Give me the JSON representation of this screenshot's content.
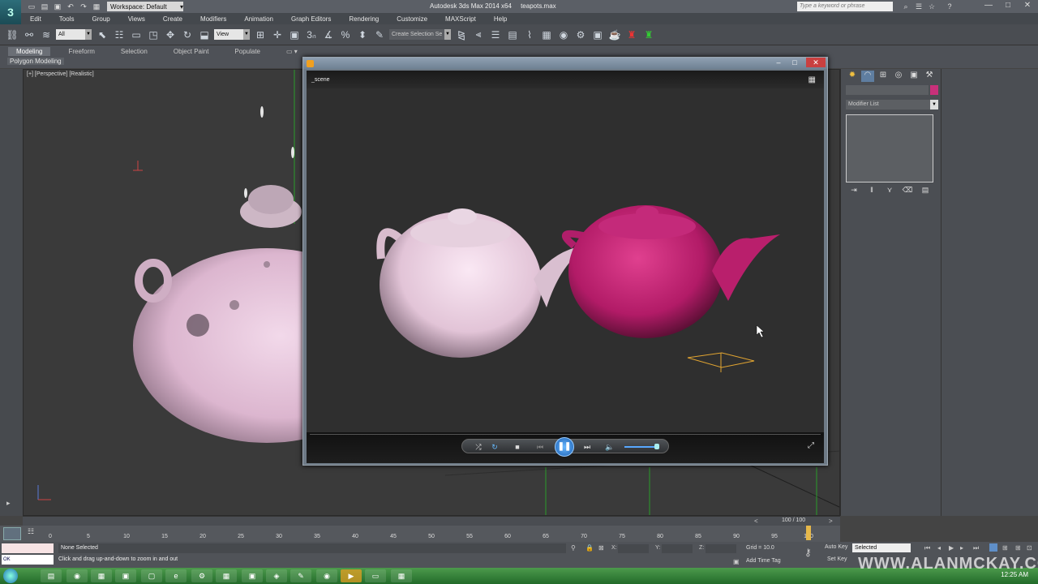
{
  "title_bar": {
    "app_title": "Autodesk 3ds Max 2014 x64",
    "file_name": "teapots.max",
    "workspace": "Workspace: Default",
    "search_placeholder": "Type a keyword or phrase"
  },
  "menu": {
    "items": [
      "Edit",
      "Tools",
      "Group",
      "Views",
      "Create",
      "Modifiers",
      "Animation",
      "Graph Editors",
      "Rendering",
      "Customize",
      "MAXScript",
      "Help"
    ]
  },
  "toolbar": {
    "selection_filter": "All",
    "reference_coord": "View",
    "named_selection": "Create Selection Se"
  },
  "ribbon": {
    "tabs": [
      "Modeling",
      "Freeform",
      "Selection",
      "Object Paint",
      "Populate"
    ],
    "panel_label": "Polygon Modeling"
  },
  "viewport": {
    "label": "[+] [Perspective] [Realistic]"
  },
  "media_player": {
    "scene_title": "_scene"
  },
  "command_panel": {
    "modifier_list": "Modifier List",
    "object_color": "#c8307a"
  },
  "timeline": {
    "frame_display": "100 / 100",
    "ticks": [
      "0",
      "5",
      "10",
      "15",
      "20",
      "25",
      "30",
      "35",
      "40",
      "45",
      "50",
      "55",
      "60",
      "65",
      "70",
      "75",
      "80",
      "85",
      "90",
      "95",
      "100"
    ]
  },
  "status": {
    "selection": "None Selected",
    "prompt": "Click and drag up-and-down to zoom in and out",
    "x_label": "X:",
    "y_label": "Y:",
    "z_label": "Z:",
    "grid": "Grid = 10.0",
    "add_time_tag": "Add Time Tag",
    "auto_key": "Auto Key",
    "set_key": "Set Key",
    "key_filter": "Selected",
    "maxscript_text": "OK"
  },
  "taskbar": {
    "clock": "12:25 AM"
  },
  "watermark": {
    "text": "WWW.ALANMCKAY.COM"
  }
}
